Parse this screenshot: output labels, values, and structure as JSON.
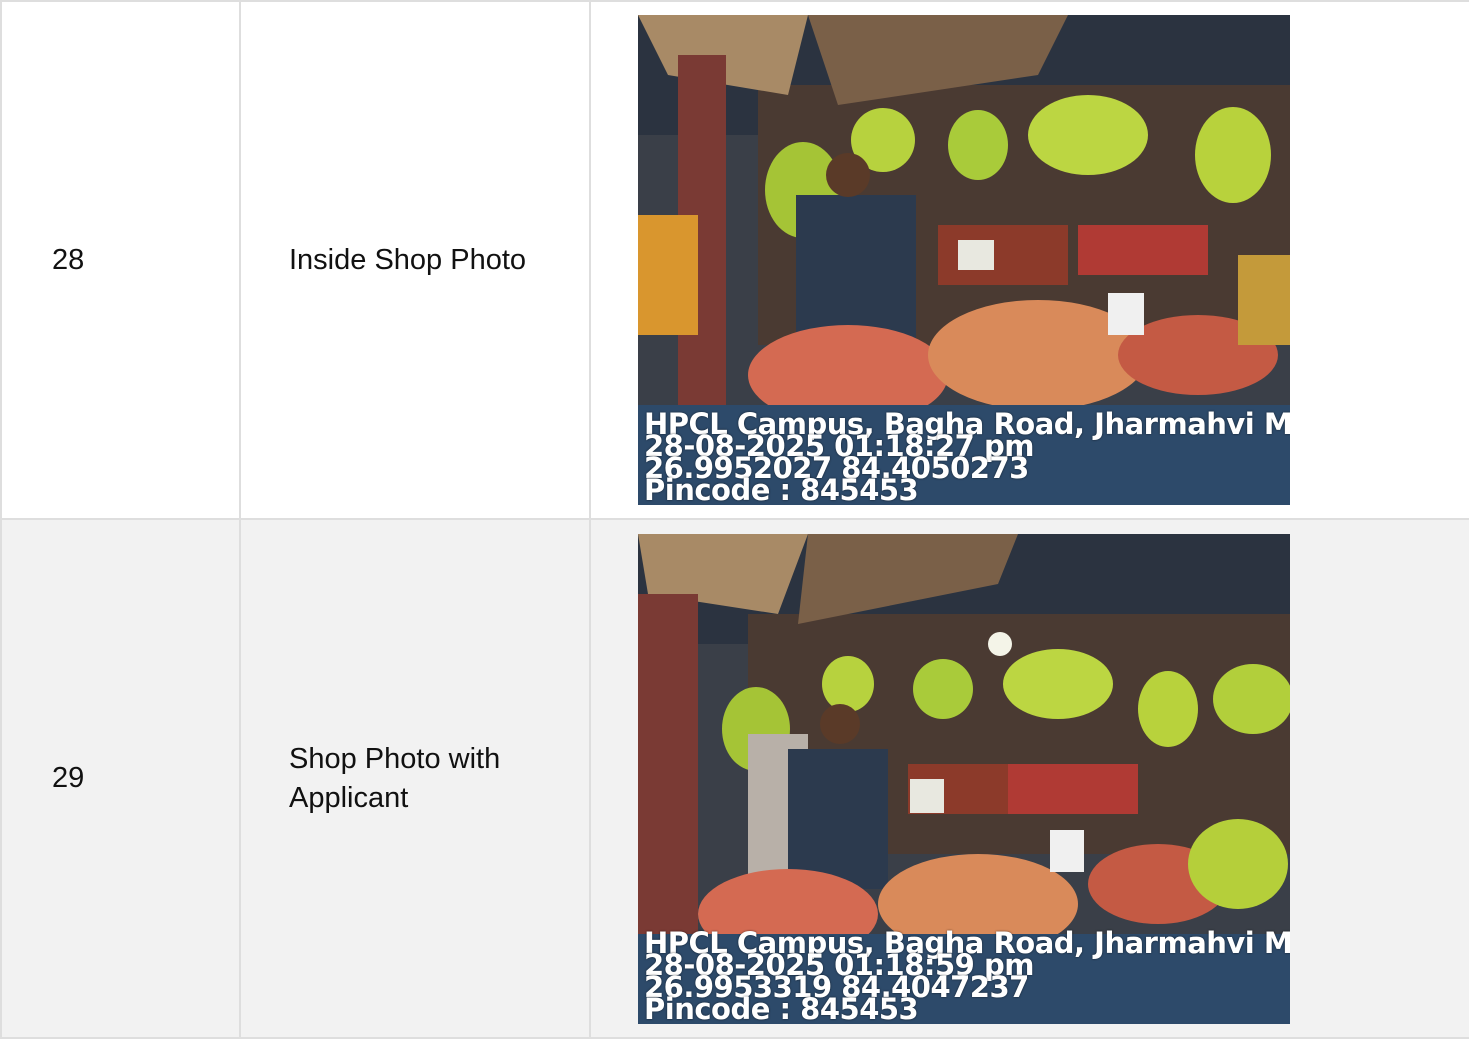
{
  "rows": [
    {
      "number": "28",
      "label": "Inside Shop Photo",
      "photo": {
        "stamp_line_1": "HPCL Campus, Bagha Road, Jharmahvi Main",
        "stamp_line_2": "28-08-2025 01:18:27 pm",
        "stamp_line_3": "26.9952027 84.4050273",
        "stamp_line_4": "Pincode : 845453"
      }
    },
    {
      "number": "29",
      "label": "Shop Photo with Applicant",
      "photo": {
        "stamp_line_1": "HPCL Campus, Bagha Road, Jharmahvi Main",
        "stamp_line_2": "28-08-2025 01:18:59 pm",
        "stamp_line_3": "26.9953319 84.4047237",
        "stamp_line_4": "Pincode : 845453"
      }
    }
  ]
}
